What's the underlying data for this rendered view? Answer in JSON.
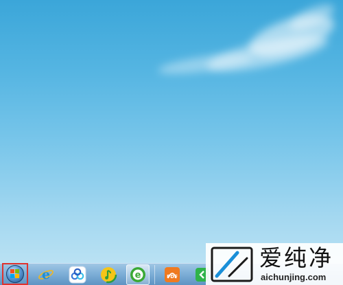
{
  "taskbar": {
    "start_icon": "windows-start-orb-icon",
    "pinned": [
      {
        "name": "internet-explorer-icon",
        "color": "#1d8fd6"
      },
      {
        "name": "baidu-netdisk-icon",
        "color": "#3a78d8"
      },
      {
        "name": "qq-music-icon",
        "color": "#f5c518"
      },
      {
        "name": "360-browser-icon",
        "color": "#3aa935"
      },
      {
        "name": "pdf-reader-icon",
        "color": "#ef7a20"
      },
      {
        "name": "green-app-icon",
        "color": "#2fb34a"
      }
    ]
  },
  "watermark": {
    "title": "爱纯净",
    "url": "aichunjing.com"
  },
  "colors": {
    "highlight": "#e0322d",
    "sky_top": "#3ba6d9",
    "sky_bottom": "#c4e6f5"
  }
}
